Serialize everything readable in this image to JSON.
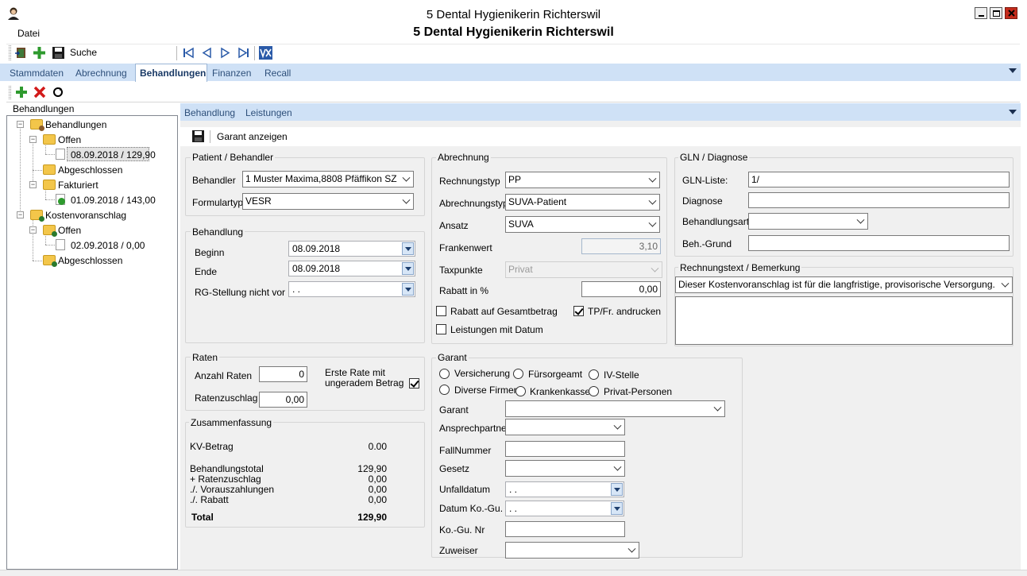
{
  "window": {
    "title": "5 Dental Hygienikerin Richterswil",
    "header_title": "5 Dental Hygienikerin Richterswil"
  },
  "menu": {
    "datei": "Datei"
  },
  "toolbar": {
    "search_label": "Suche"
  },
  "main_tabs": [
    {
      "label": "Stammdaten"
    },
    {
      "label": "Abrechnung"
    },
    {
      "label": "Behandlungen",
      "active": true
    },
    {
      "label": "Finanzen"
    },
    {
      "label": "Recall"
    }
  ],
  "tree": {
    "title": "Behandlungen",
    "nodes": [
      {
        "label": "Behandlungen"
      },
      {
        "label": "Offen"
      },
      {
        "label": "08.09.2018 / 129,90",
        "selected": true
      },
      {
        "label": "Abgeschlossen"
      },
      {
        "label": "Fakturiert"
      },
      {
        "label": "01.09.2018 / 143,00"
      },
      {
        "label": "Kostenvoranschlag"
      },
      {
        "label": "Offen"
      },
      {
        "label": "02.09.2018 / 0,00"
      },
      {
        "label": "Abgeschlossen"
      }
    ]
  },
  "sub_tabs": [
    {
      "label": "Behandlung"
    },
    {
      "label": "Leistungen"
    }
  ],
  "form_toolbar": {
    "garant_anzeigen": "Garant anzeigen"
  },
  "patient": {
    "title": "Patient / Behandler",
    "behandler_label": "Behandler",
    "behandler_value": "1 Muster Maxima,8808 Pfäffikon SZ",
    "formulartyp_label": "Formulartyp",
    "formulartyp_value": "VESR"
  },
  "behandlung": {
    "title": "Behandlung",
    "beginn_label": "Beginn",
    "beginn_value": "08.09.2018",
    "ende_label": "Ende",
    "ende_value": "08.09.2018",
    "rg_label": "RG-Stellung nicht vor",
    "rg_value": ". ."
  },
  "raten": {
    "title": "Raten",
    "anzahl_label": "Anzahl Raten",
    "anzahl_value": "0",
    "zuschlag_label": "Ratenzuschlag",
    "zuschlag_value": "0,00",
    "erste_rate_label": "Erste Rate mit ungeradem Betrag",
    "erste_rate_checked": true
  },
  "zusammenfassung": {
    "title": "Zusammenfassung",
    "kv_label": "KV-Betrag",
    "kv_value": "0.00",
    "rows": [
      {
        "label": "Behandlungstotal",
        "value": "129,90"
      },
      {
        "label": "+ Ratenzuschlag",
        "value": "0,00"
      },
      {
        "label": "./. Vorauszahlungen",
        "value": "0,00"
      },
      {
        "label": "./. Rabatt",
        "value": "0,00"
      }
    ],
    "total_label": "Total",
    "total_value": "129,90"
  },
  "abrechnung": {
    "title": "Abrechnung",
    "rechnungstyp_label": "Rechnungstyp",
    "rechnungstyp_value": "PP",
    "abrechnungstyp_label": "Abrechnungstyp",
    "abrechnungstyp_value": "SUVA-Patient",
    "ansatz_label": "Ansatz",
    "ansatz_value": "SUVA",
    "frankenwert_label": "Frankenwert",
    "frankenwert_value": "3,10",
    "taxpunkte_label": "Taxpunkte",
    "taxpunkte_value": "Privat",
    "rabatt_label": "Rabatt in %",
    "rabatt_value": "0,00",
    "rabatt_gesamt_label": "Rabatt auf Gesamtbetrag",
    "tp_label": "TP/Fr. andrucken",
    "leistungen_datum_label": "Leistungen mit Datum"
  },
  "garant": {
    "title": "Garant",
    "radios": [
      {
        "label": "Versicherung"
      },
      {
        "label": "Fürsorgeamt"
      },
      {
        "label": "IV-Stelle"
      },
      {
        "label": "Diverse Firmen"
      },
      {
        "label": "Krankenkasse"
      },
      {
        "label": "Privat-Personen"
      }
    ],
    "garant_label": "Garant",
    "ansprechpartner_label": "Ansprechpartner",
    "fallnummer_label": "FallNummer",
    "gesetz_label": "Gesetz",
    "unfalldatum_label": "Unfalldatum",
    "unfalldatum_value": ". .",
    "datum_kogu_label": "Datum Ko.-Gu.",
    "datum_kogu_value": ". .",
    "kogu_nr_label": "Ko.-Gu. Nr",
    "zuweiser_label": "Zuweiser"
  },
  "gln": {
    "title": "GLN / Diagnose",
    "gln_label": "GLN-Liste:",
    "gln_value": "1/",
    "diagnose_label": "Diagnose",
    "behandlungsart_label": "Behandlungsart",
    "grund_label": "Beh.-Grund"
  },
  "rechnungstext": {
    "title": "Rechnungstext / Bemerkung",
    "value": "Dieser Kostenvoranschlag ist für die langfristige, provisorische Versorgung."
  }
}
